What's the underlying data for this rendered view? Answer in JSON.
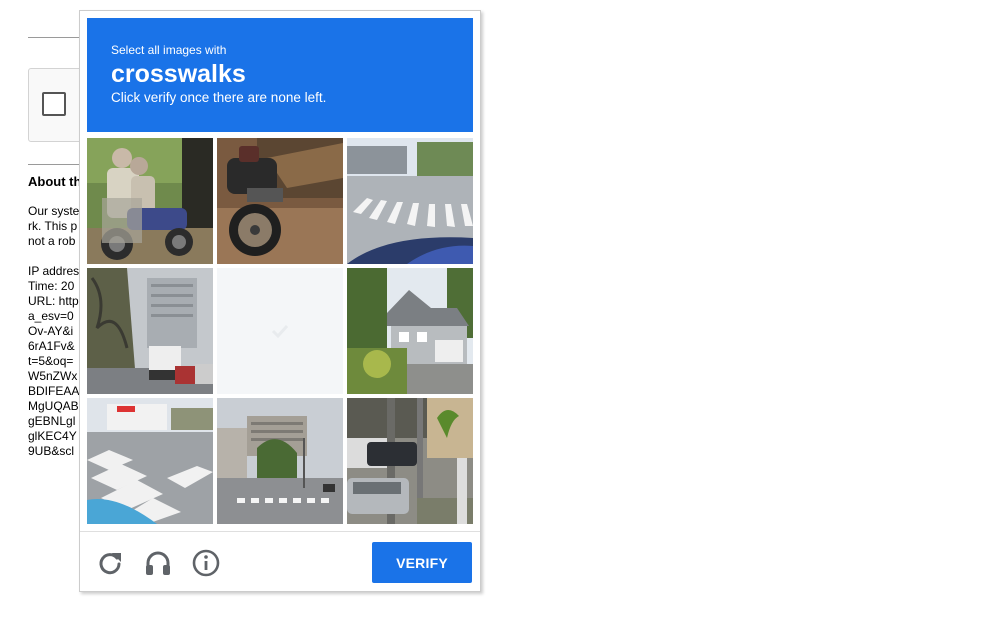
{
  "background_page": {
    "checkbox_icon": "checkbox-unchecked-icon",
    "about_heading": "About th",
    "paragraph_lines": [
      "Our syste",
      "rk. This p",
      "not a rob"
    ],
    "info_lines": [
      "IP addres",
      "Time: 20",
      "URL: http",
      "a_esv=0",
      "Ov-AY&i",
      "6rA1Fv&",
      "t=5&oq=",
      "W5nZWx",
      "BDIFEAA",
      "MgUQAB",
      "gEBNLgl",
      "glKEC4Y",
      "9UB&scl"
    ]
  },
  "captcha": {
    "header": {
      "instruction": "Select all images with",
      "target": "crosswalks",
      "subtext": "Click verify once there are none left."
    },
    "tiles": [
      {
        "row": 1,
        "col": 1,
        "content": "people on motorcycle"
      },
      {
        "row": 1,
        "col": 2,
        "content": "parked motorcycle on dirt"
      },
      {
        "row": 1,
        "col": 3,
        "content": "crosswalk"
      },
      {
        "row": 2,
        "col": 1,
        "content": "street with cars and trees"
      },
      {
        "row": 2,
        "col": 2,
        "content": "fading replaced tile"
      },
      {
        "row": 2,
        "col": 3,
        "content": "house"
      },
      {
        "row": 3,
        "col": 1,
        "content": "crosswalk"
      },
      {
        "row": 3,
        "col": 2,
        "content": "street with crosswalk"
      },
      {
        "row": 3,
        "col": 3,
        "content": "parked cars with palm tree"
      }
    ],
    "footer": {
      "reload_icon": "reload-icon",
      "audio_icon": "headphones-icon",
      "info_icon": "info-icon",
      "verify_label": "VERIFY"
    },
    "colors": {
      "accent": "#1a73e8",
      "icon_gray": "#5f6368"
    }
  }
}
